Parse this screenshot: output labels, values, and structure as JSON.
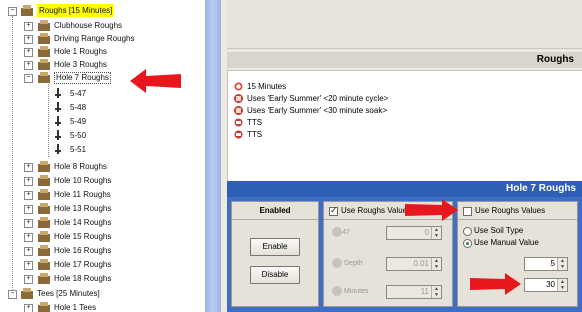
{
  "tree": {
    "root": {
      "label": "Roughs",
      "duration": "[15 Minutes]"
    },
    "items": [
      "Clubhouse Roughs",
      "Driving Range Roughs",
      "Hole 1 Roughs",
      "Hole 3 Roughs",
      "Hole 7 Roughs"
    ],
    "zones": [
      "5-47",
      "5-48",
      "5-49",
      "5-50",
      "5-51"
    ],
    "items_after": [
      "Hole 8 Roughs",
      "Hole 10 Roughs",
      "Hole 11 Roughs",
      "Hole 13 Roughs",
      "Hole 14 Roughs",
      "Hole 15 Roughs",
      "Hole 16 Roughs",
      "Hole 17 Roughs",
      "Hole 18 Roughs"
    ],
    "tees": {
      "label": "Tees",
      "duration": "[25 Minutes]"
    },
    "last": "Hole 1 Tees"
  },
  "right": {
    "roughs_header": "Roughs",
    "info_lines": [
      {
        "text": "15 Minutes",
        "icon": "clock-icon"
      },
      {
        "text": "Uses 'Early Summer' <20 minute cycle>",
        "icon": "program-icon"
      },
      {
        "text": "Uses 'Early Summer' <30 minute soak>",
        "icon": "program-icon"
      },
      {
        "text": "TTS",
        "icon": "tts-icon"
      },
      {
        "text": "TTS",
        "icon": "tts-icon"
      }
    ],
    "hole_header": "Hole 7 Roughs",
    "enabled_label": "Enabled",
    "enable_button": "Enable",
    "disable_button": "Disable",
    "use_roughs_values_checked": "Use Roughs Values",
    "use_roughs_values_unchecked": "Use Roughs Values",
    "disabled_fields": [
      {
        "label": "5-47",
        "value": "0"
      },
      {
        "label": "Depth",
        "value": "0.01"
      },
      {
        "label": "Minutes",
        "value": "11"
      }
    ],
    "use_soil_type": "Use Soil Type",
    "use_manual_value": "Use Manual Value",
    "manual_values": [
      "5",
      "30"
    ]
  },
  "colors": {
    "arrow": "#e8171d",
    "header_blue": "#2f5fb4",
    "selection": "#ffff00"
  }
}
